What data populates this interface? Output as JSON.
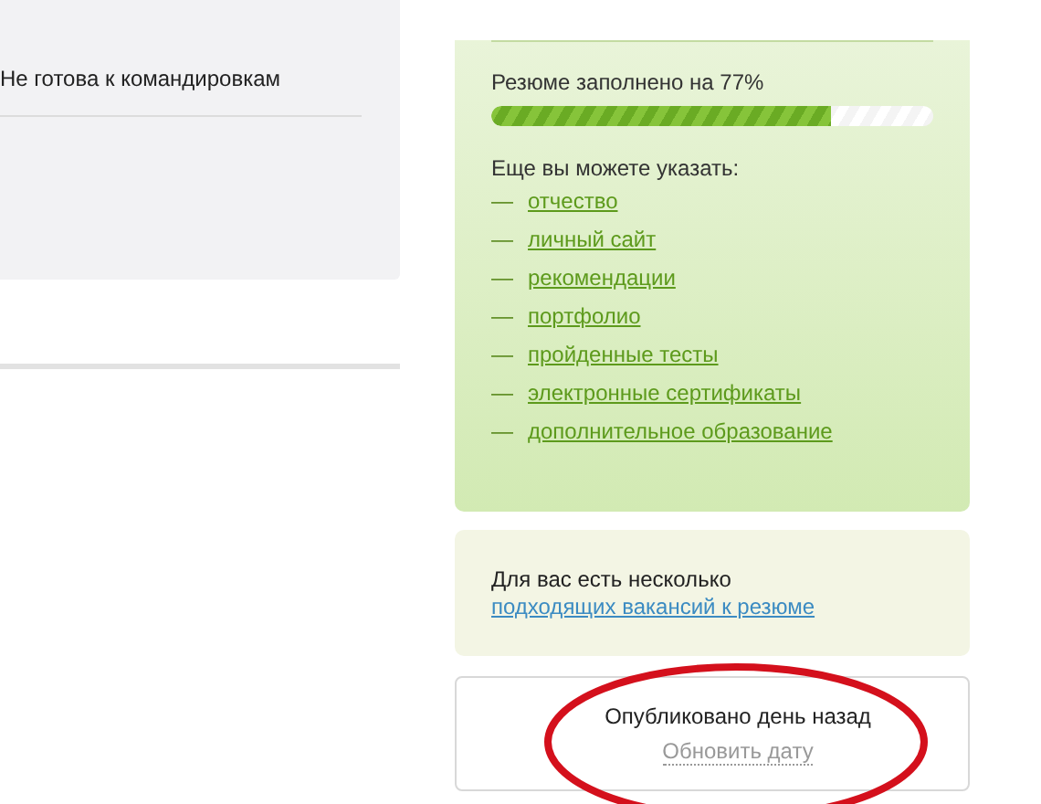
{
  "left_panel": {
    "business_trips": "Не готова к командировкам"
  },
  "resume_progress": {
    "label": "Резюме заполнено на 77%",
    "level": 0.77
  },
  "suggestions": {
    "heading": "Еще вы можете указать:",
    "marker": "—",
    "items": [
      "отчество",
      "личный сайт",
      "рекомендации",
      "портфолио",
      "пройденные тесты",
      "электронные сертификаты",
      "дополнительное образование"
    ]
  },
  "vacancies_notice": {
    "text": "Для вас есть несколько",
    "link": "подходящих вакансий к резюме"
  },
  "publication": {
    "status": "Опубликовано день назад",
    "action": "Обновить дату"
  }
}
